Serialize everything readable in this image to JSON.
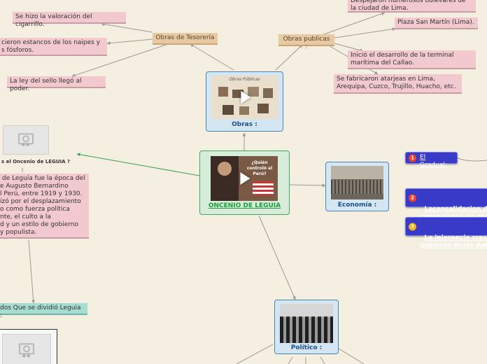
{
  "center": {
    "label": "ONCENIO DE LEGUIA",
    "thumb_text": "¿Quién controló al Perú?"
  },
  "obras": {
    "label": "Obras :",
    "thumb_text": "Obras Públicas"
  },
  "economia": {
    "label": "Economía :"
  },
  "politico": {
    "label": "Político :"
  },
  "tesoreria": {
    "label": "Obras de Tesorería",
    "items": [
      "Se hizo la valoración del cigarrillo.",
      "cieron estancos de los naipes y\ns fósforos.",
      "La ley del sello llegó al poder."
    ]
  },
  "publicas": {
    "label": "Obras publicas :",
    "items": [
      "Despejaron numerosos bulevares de\nla ciudad de Lima.",
      "Plaza San Martín (Lima).",
      "Inició el desarrollo de la terminal\nmarítima del Callao.",
      "Se fabricaron atarjeas en Lima,\nArequipa, Cuzco, Trujillo, Huacho, etc."
    ]
  },
  "left_panel": {
    "question": "s el Oncenio de LEGUIA ?",
    "description": " de Leguía fue la época del\ne Augusto Bernardino\nl Perú, entre 1919 y 1930.\nizó por el desplazamiento\no como fuerza política\nnte, el culto a la\nd y un estilo de gobierno\ny populista.",
    "divided": "dos Que se dividió Leguia :"
  },
  "economy_items": [
    {
      "num": "1",
      "text": "El Gradual:",
      "color": "#e8452c"
    },
    {
      "num": "2",
      "text": "Laconsolidacion de\nconcesiones de nue",
      "color": "#e8452c"
    },
    {
      "num": "3",
      "text": "La injerencia crecie\ngobierno Norte Am",
      "color": "#f2b51b"
    }
  ]
}
